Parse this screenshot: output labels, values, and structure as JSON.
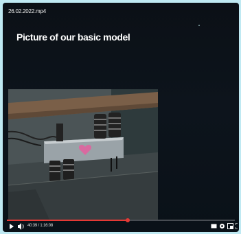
{
  "video": {
    "filename": "26.02.2022.mp4",
    "slide_title": "Picture of our basic model",
    "current_time": "40:39 / 1:16:08",
    "progress": 0.53
  },
  "icons": {
    "play": "play-icon",
    "volume": "volume-icon",
    "captions": "captions-icon",
    "settings": "settings-icon",
    "miniplayer": "miniplayer-icon",
    "fullscreen": "fullscreen-icon"
  },
  "colors": {
    "progress": "#e53935",
    "background": "#bfe9f2",
    "video_bg": "#0b1016"
  }
}
